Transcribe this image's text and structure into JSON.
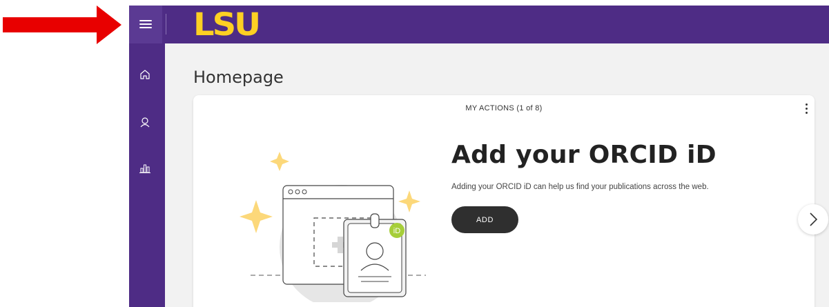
{
  "header": {
    "logo_text": "LSU",
    "menu_icon": "hamburger-menu-icon",
    "brand_purple": "#4e2c85",
    "brand_gold": "#fdd023"
  },
  "annotation": {
    "arrow_icon": "red-arrow-icon",
    "arrow_color": "#e80000"
  },
  "sidebar": {
    "items": [
      {
        "icon": "home-icon"
      },
      {
        "icon": "user-icon"
      },
      {
        "icon": "bar-chart-icon"
      }
    ]
  },
  "page": {
    "title": "Homepage"
  },
  "card": {
    "header": "MY ACTIONS (1 of 8)",
    "title": "Add your ORCID iD",
    "description": "Adding your ORCID iD can help us find your publications across the web.",
    "button_label": "ADD",
    "badge_text": "iD",
    "badge_color": "#a6ce39",
    "sparkle_color": "#fcd87a",
    "menu_icon": "more-vertical-icon",
    "next_icon": "chevron-right-icon"
  }
}
